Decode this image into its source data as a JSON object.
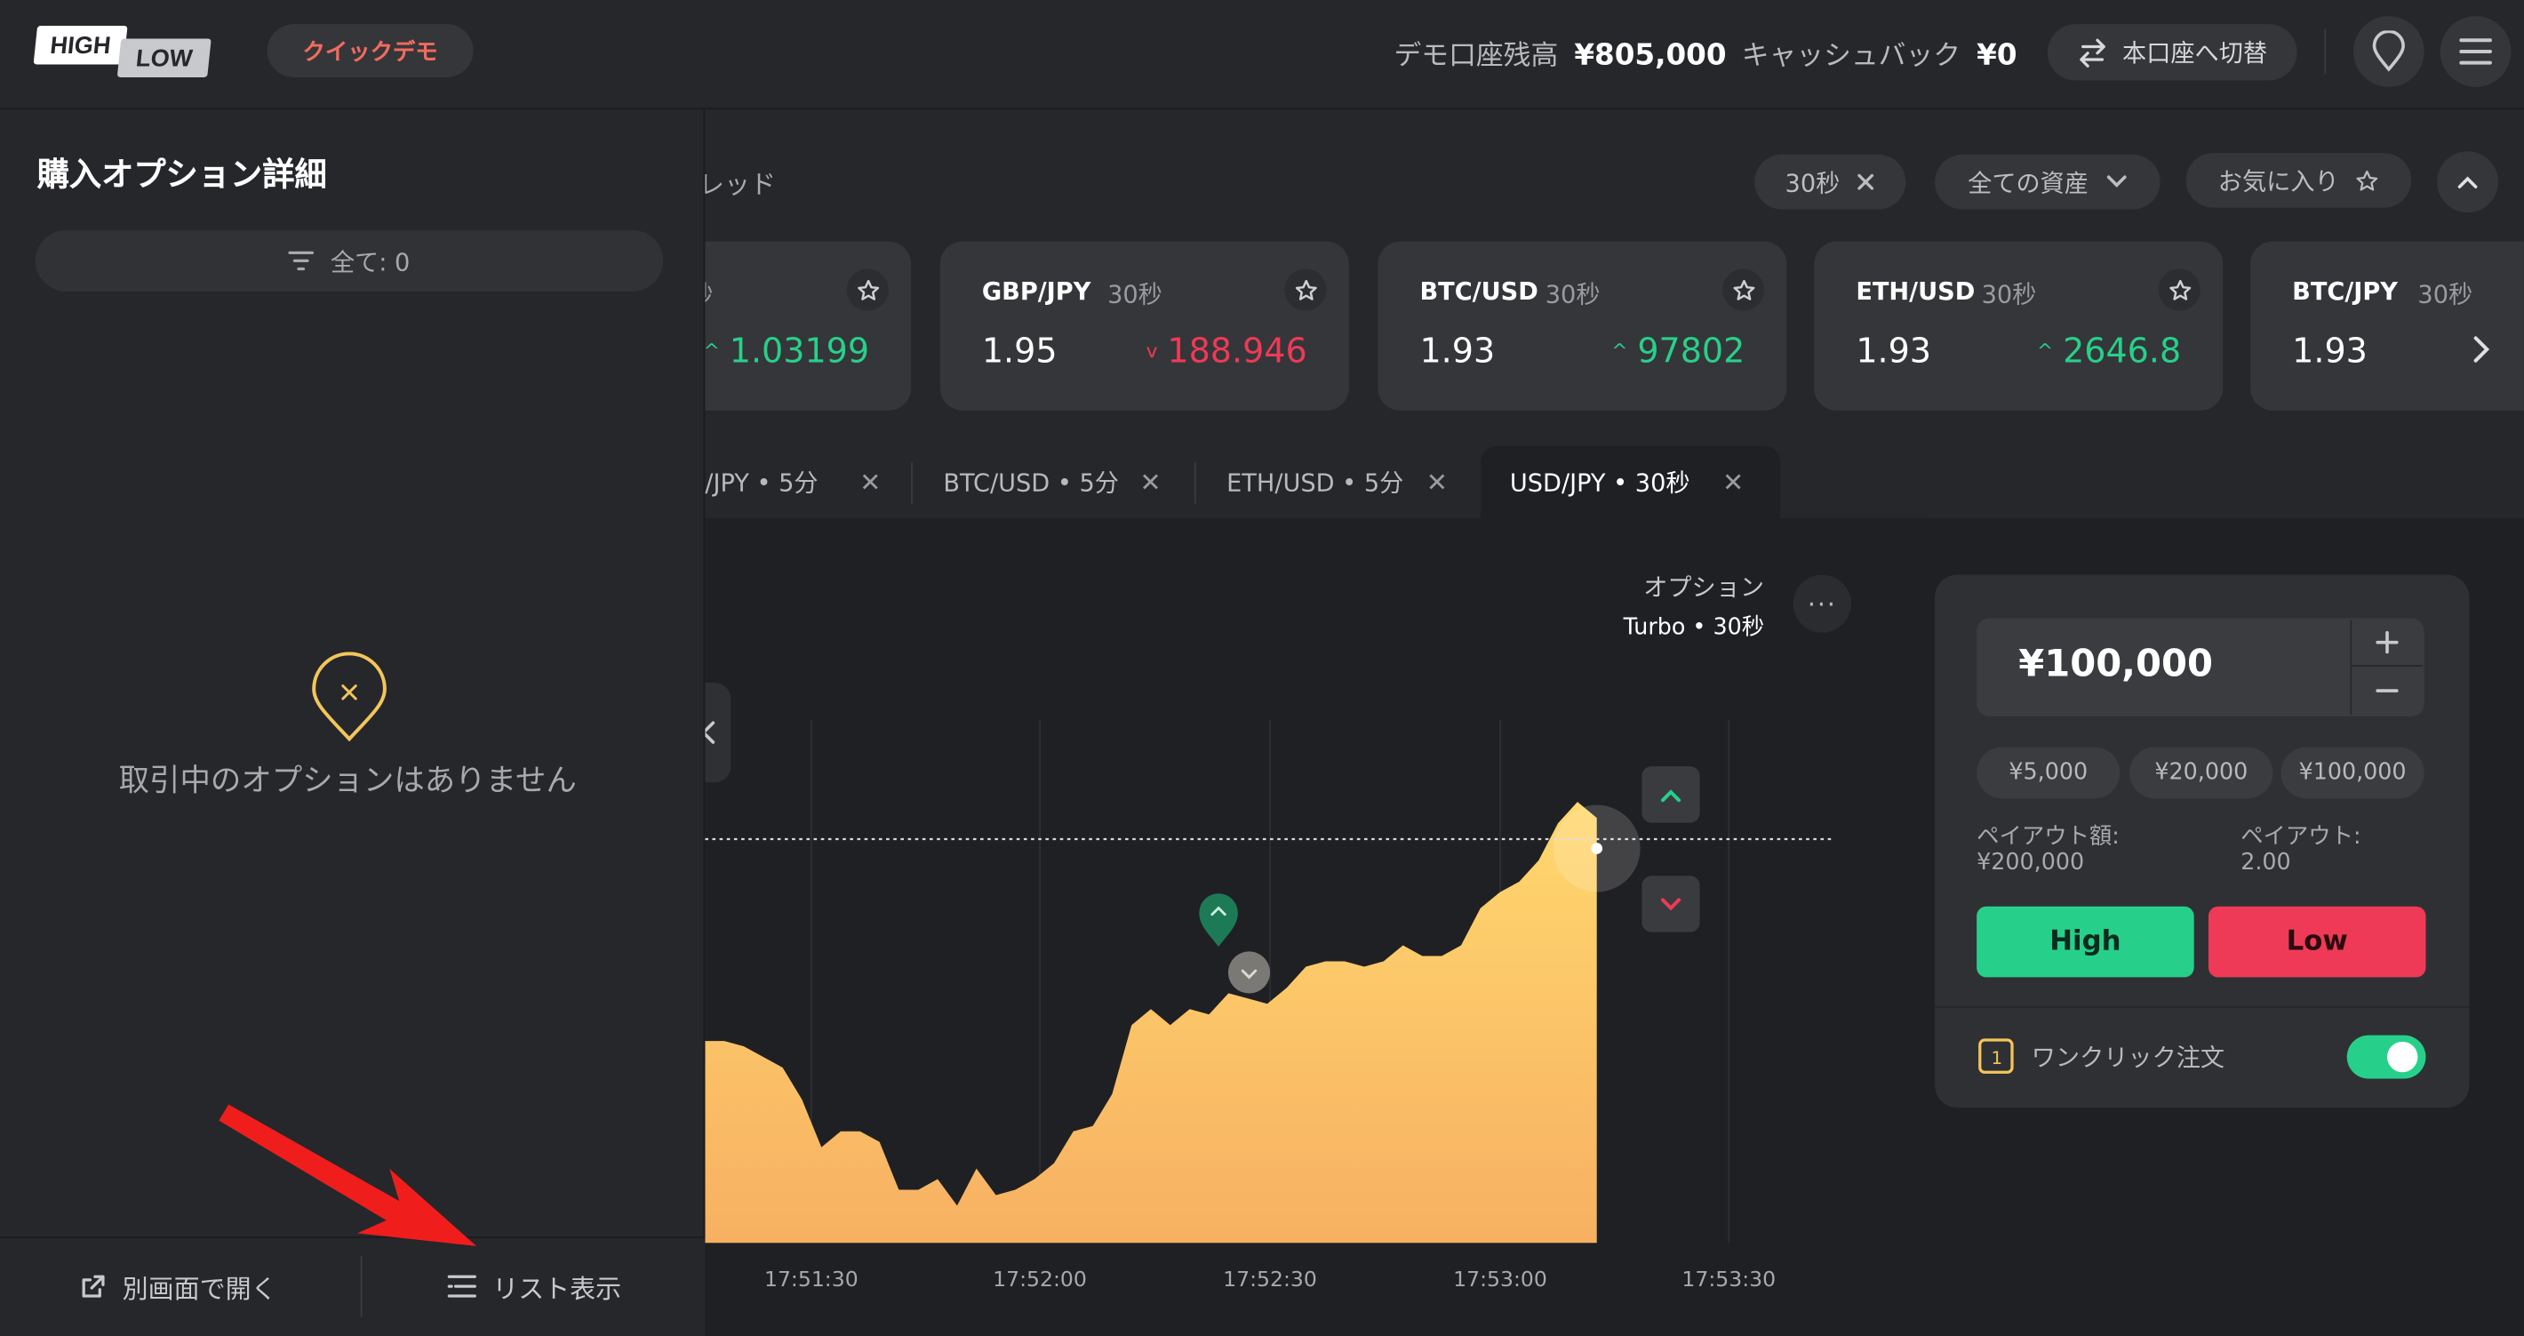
{
  "header": {
    "logo_top": "HIGH",
    "logo_bottom": "LOW",
    "demo_badge": "クイックデモ",
    "balance_label": "デモ口座残高",
    "balance_value": "¥805,000",
    "cashback_label": "キャッシュバック",
    "cashback_value": "¥0",
    "switch_label": "本口座へ切替"
  },
  "left_panel": {
    "title": "購入オプション詳細",
    "filter_label": "全て: 0",
    "empty_message": "取引中のオプションはありません",
    "open_new_window": "別画面で開く",
    "list_view": "リスト表示"
  },
  "section_title": "ブレッド",
  "filters": {
    "duration": "30秒",
    "all_assets": "全ての資産",
    "favorites": "お気に入り"
  },
  "asset_cards": [
    {
      "pair": "",
      "duration": "秒",
      "payout": "",
      "price": "1.03199",
      "direction": "up"
    },
    {
      "pair": "GBP/JPY",
      "duration": "30秒",
      "payout": "1.95",
      "price": "188.946",
      "direction": "down"
    },
    {
      "pair": "BTC/USD",
      "duration": "30秒",
      "payout": "1.93",
      "price": "97802",
      "direction": "up"
    },
    {
      "pair": "ETH/USD",
      "duration": "30秒",
      "payout": "1.93",
      "price": "2646.8",
      "direction": "up"
    },
    {
      "pair": "BTC/JPY",
      "duration": "30秒",
      "payout": "1.93",
      "price": "",
      "direction": "down"
    }
  ],
  "tabs": [
    {
      "label": "/JPY • 5分",
      "active": false
    },
    {
      "label": "BTC/USD • 5分",
      "active": false
    },
    {
      "label": "ETH/USD • 5分",
      "active": false
    },
    {
      "label": "USD/JPY • 30秒",
      "active": true
    }
  ],
  "chart_info": {
    "option_label": "オプション",
    "option_type": "Turbo • 30秒"
  },
  "chart_data": {
    "type": "area",
    "title": "",
    "xlabel": "",
    "ylabel": "",
    "x_ticks": [
      "17:51:30",
      "17:52:00",
      "17:52:30",
      "17:53:00",
      "17:53:30"
    ],
    "strike_level": 0.76,
    "series": [
      {
        "values": [
          0.38,
          0.38,
          0.37,
          0.35,
          0.33,
          0.27,
          0.18,
          0.21,
          0.21,
          0.19,
          0.1,
          0.1,
          0.12,
          0.07,
          0.14,
          0.09,
          0.1,
          0.12,
          0.15,
          0.21,
          0.22,
          0.28,
          0.41,
          0.44,
          0.41,
          0.44,
          0.43,
          0.47,
          0.46,
          0.45,
          0.48,
          0.52,
          0.53,
          0.53,
          0.52,
          0.53,
          0.56,
          0.54,
          0.54,
          0.56,
          0.63,
          0.66,
          0.68,
          0.72,
          0.79,
          0.83,
          0.8
        ]
      }
    ],
    "colors": {
      "fill_top": "#ffd86e",
      "fill_bottom": "#f7b062",
      "strike": "#d9d9d9"
    }
  },
  "trade": {
    "amount": "¥100,000",
    "presets": [
      "¥5,000",
      "¥20,000",
      "¥100,000"
    ],
    "payout_amount_label": "ペイアウト額:",
    "payout_amount_value": "¥200,000",
    "payout_label": "ペイアウト:",
    "payout_value": "2.00",
    "high_label": "High",
    "low_label": "Low",
    "one_click_label": "ワンクリック注文",
    "one_click_on": true
  },
  "colors": {
    "up": "#27d08a",
    "down": "#ee3a56",
    "accent_gold": "#f3c55a",
    "demo_badge_text": "#f26b5e",
    "annotation_arrow": "#f01d1d"
  }
}
